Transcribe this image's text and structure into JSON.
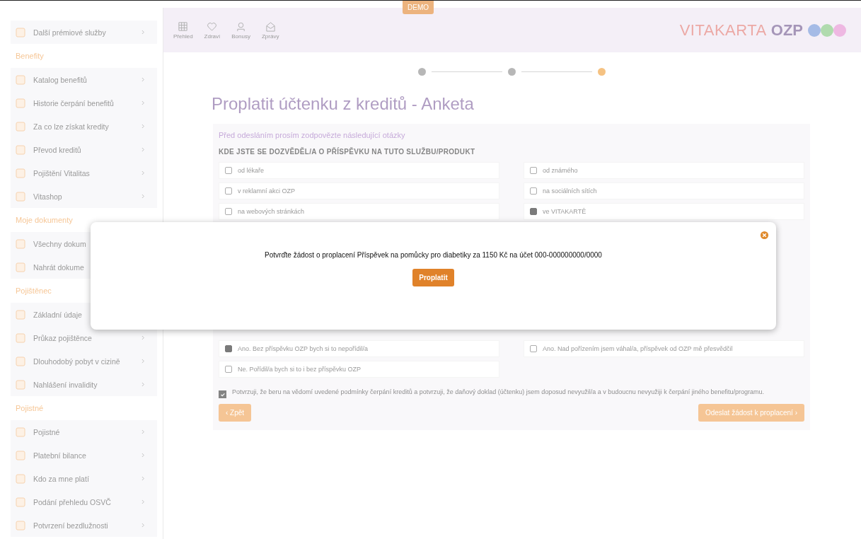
{
  "sidebar": {
    "items": [
      {
        "kind": "item",
        "label": "Další prémiové služby",
        "chevron": true
      },
      {
        "kind": "section",
        "label": "Benefity"
      },
      {
        "kind": "item",
        "label": "Katalog benefitů",
        "chevron": true
      },
      {
        "kind": "item",
        "label": "Historie čerpání benefitů",
        "chevron": true
      },
      {
        "kind": "item",
        "label": "Za co lze získat kredity",
        "chevron": true
      },
      {
        "kind": "item",
        "label": "Převod kreditů",
        "chevron": true
      },
      {
        "kind": "item",
        "label": "Pojištění Vitalitas",
        "chevron": true
      },
      {
        "kind": "item",
        "label": "Vitashop",
        "chevron": true
      },
      {
        "kind": "section",
        "label": "Moje dokumenty"
      },
      {
        "kind": "item",
        "label": "Všechny dokum",
        "chevron": false
      },
      {
        "kind": "item",
        "label": "Nahrát dokume",
        "chevron": false
      },
      {
        "kind": "section",
        "label": "Pojištěnec"
      },
      {
        "kind": "item",
        "label": "Základní údaje",
        "chevron": false
      },
      {
        "kind": "item",
        "label": "Průkaz pojištěnce",
        "chevron": true
      },
      {
        "kind": "item",
        "label": "Dlouhodobý pobyt v cizině",
        "chevron": true
      },
      {
        "kind": "item",
        "label": "Nahlášení invalidity",
        "chevron": true
      },
      {
        "kind": "section",
        "label": "Pojistné"
      },
      {
        "kind": "item",
        "label": "Pojistné",
        "chevron": true
      },
      {
        "kind": "item",
        "label": "Platební bilance",
        "chevron": true
      },
      {
        "kind": "item",
        "label": "Kdo za mne platí",
        "chevron": true
      },
      {
        "kind": "item",
        "label": "Podání přehledu OSVČ",
        "chevron": true
      },
      {
        "kind": "item",
        "label": "Potvrzení bezdlužnosti",
        "chevron": true
      }
    ]
  },
  "header": {
    "nav": [
      {
        "kind": "grid",
        "label": "Přehled"
      },
      {
        "kind": "heart",
        "label": "Zdraví"
      },
      {
        "kind": "badge",
        "label": "Bonusy"
      },
      {
        "kind": "mail",
        "label": "Zprávy"
      }
    ],
    "badge": "DEMO",
    "logo_light": "VITAKARTA",
    "logo_bold": "OZP"
  },
  "steps": [
    {
      "selected": false
    },
    {
      "selected": false
    },
    {
      "selected": true
    }
  ],
  "title": "Proplatit účtenku z kreditů - Anketa",
  "form": {
    "intro": "Před odesláním prosím zodpovězte následující otázky",
    "question": "KDE JSTE SE DOZVĚDĚL/A O PŘÍSPĚVKU NA TUTO SLUŽBU/PRODUKT",
    "options": [
      {
        "label": "od lékaře",
        "selected": false
      },
      {
        "label": "od známého",
        "selected": false
      },
      {
        "label": "v reklamní akci OZP",
        "selected": false
      },
      {
        "label": "na sociálních sítích",
        "selected": false
      },
      {
        "label": "na webových stránkách",
        "selected": false
      },
      {
        "label": "ve VITAKARTĚ",
        "selected": true
      }
    ],
    "options_2": [
      {
        "label": "Ano. Bez příspěvku OZP bych si to nepořídil/a",
        "selected": true
      },
      {
        "label": "Ano. Nad pořízením jsem váhal/a, příspěvek od OZP mě přesvědčil",
        "selected": false
      },
      {
        "label": "Ne. Pořídil/a bych si to i bez příspěvku OZP",
        "selected": false
      }
    ],
    "consent": {
      "text": "Potvrzuji, že beru na vědomí uvedené podmínky čerpání kreditů a potvrzuji, že daňový doklad (účtenku) jsem doposud nevyužil/a a v budoucnu nevyužiji k čerpání jiného benefitu/programu.",
      "checked": true
    },
    "back": "‹ Zpět",
    "submit": "Odeslat žádost k proplacení ›"
  },
  "modal": {
    "text": "Potvrďte žádost o proplacení Příspěvek na pomůcky pro diabetiky za 1150 Kč na účet 000-000000000/0000",
    "button": "Proplatit"
  }
}
